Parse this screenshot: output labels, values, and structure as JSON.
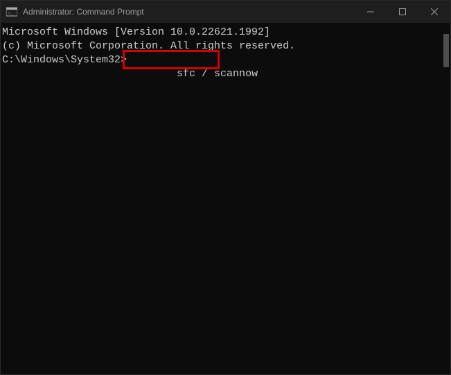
{
  "titlebar": {
    "title": "Administrator: Command Prompt"
  },
  "terminal": {
    "line1": "Microsoft Windows [Version 10.0.22621.1992]",
    "line2": "(c) Microsoft Corporation. All rights reserved.",
    "blank1": "",
    "prompt": "C:\\Windows\\System32>",
    "command": "sfc / scannow"
  }
}
